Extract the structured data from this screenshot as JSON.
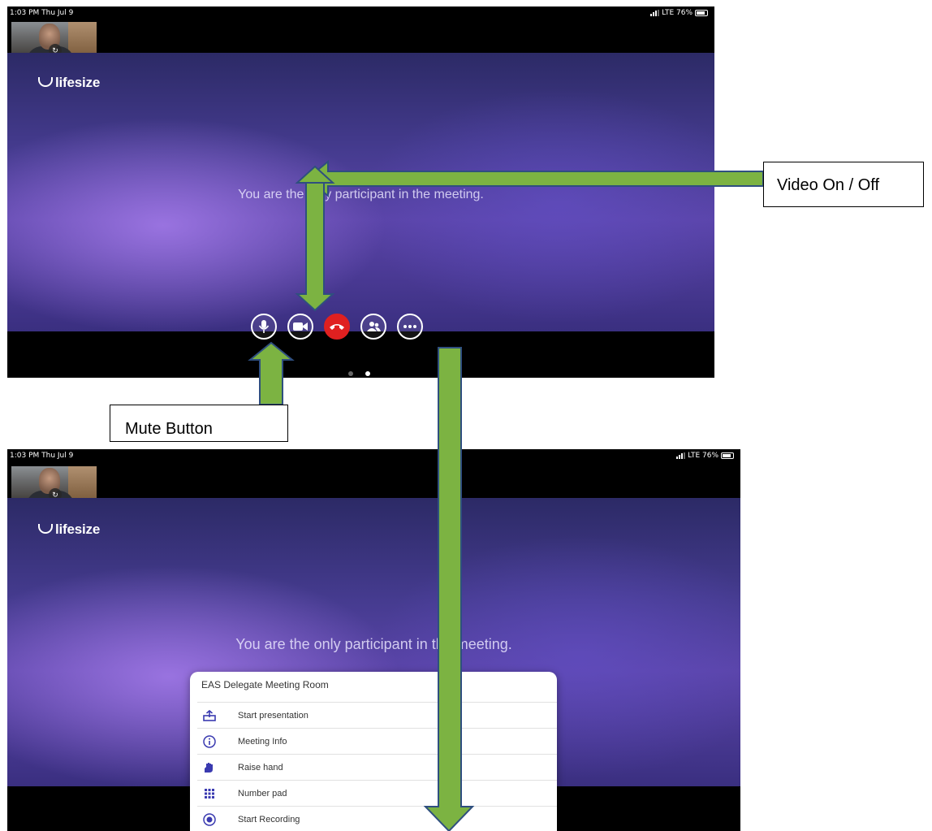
{
  "status_bar": {
    "time": "1:03 PM  Thu Jul 9",
    "network": "LTE 76%"
  },
  "brand": {
    "logo_text": "lifesize"
  },
  "meeting": {
    "message_1": "You are the only participant in the meeting.",
    "message_2": "You are the only participant in the meeting."
  },
  "controls": [
    "microphone-icon",
    "video-camera-icon",
    "end-call-icon",
    "participants-icon",
    "more-options-icon"
  ],
  "menu": {
    "title": "EAS Delegate Meeting Room",
    "items": [
      {
        "label": "Start presentation",
        "icon": "share-screen-icon"
      },
      {
        "label": "Meeting Info",
        "icon": "info-icon"
      },
      {
        "label": "Raise hand",
        "icon": "hand-icon"
      },
      {
        "label": "Number pad",
        "icon": "keypad-icon"
      },
      {
        "label": "Start Recording",
        "icon": "record-icon"
      }
    ]
  },
  "annotations": {
    "video_toggle": "Video On / Off",
    "mute": "Mute Button"
  },
  "colors": {
    "arrow_fill": "#7cb342",
    "arrow_stroke": "#2f4f7f",
    "end_call": "#e02020",
    "background_purple": "#5a44a8"
  }
}
